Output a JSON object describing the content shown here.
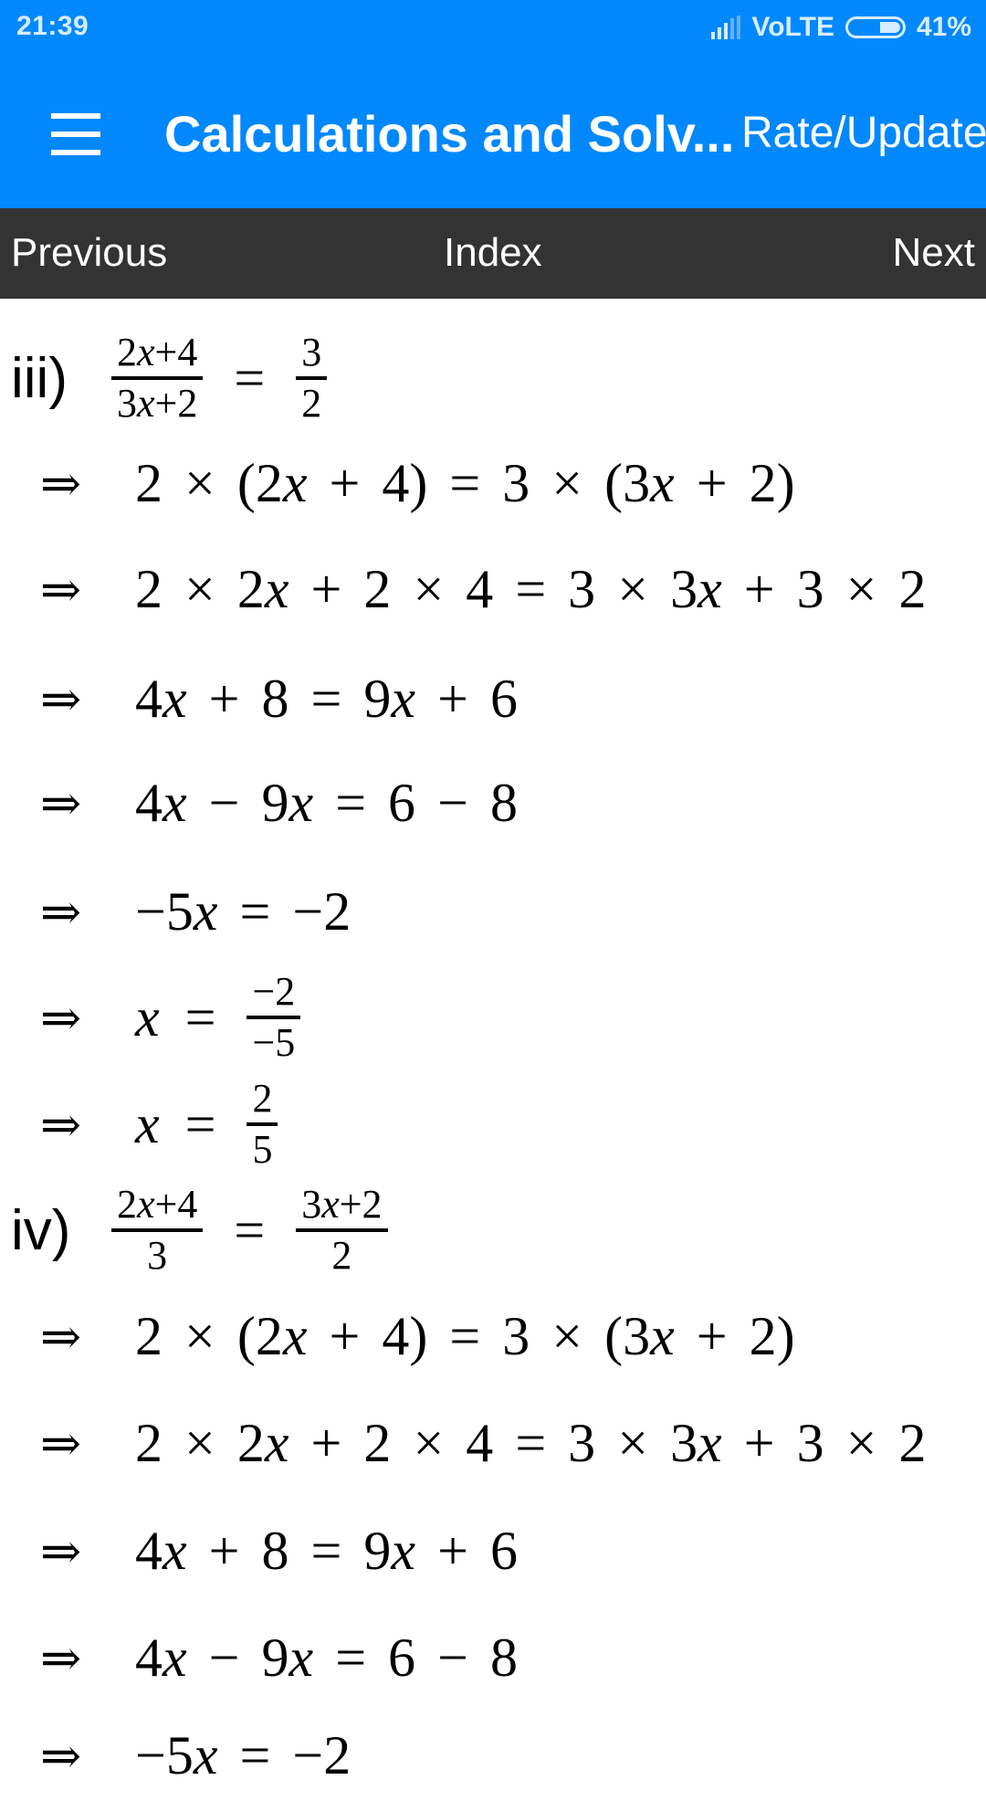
{
  "status_bar": {
    "time": "21:39",
    "network": "VoLTE",
    "battery_percent": "41%",
    "battery_level": 0.41,
    "signal_icon": "cell-signal-icon",
    "battery_icon": "battery-icon"
  },
  "app_bar": {
    "menu_icon": "hamburger-menu-icon",
    "title": "Calculations and Solv...",
    "rate_update_label": "Rate/Update"
  },
  "nav_bar": {
    "previous_label": "Previous",
    "index_label": "Index",
    "next_label": "Next"
  },
  "colors": {
    "primary": "#0288fd",
    "nav_background": "#333333",
    "text": "#000000"
  },
  "problems": [
    {
      "label": "iii)",
      "equation": {
        "lhs_num": "2x+4",
        "lhs_den": "3x+2",
        "eq": "=",
        "rhs_num": "3",
        "rhs_den": "2"
      },
      "arrow": "⇒",
      "steps": [
        "2 × (2x + 4) = 3 × (3x + 2)",
        "2 × 2x + 2 × 4 = 3 × 3x + 3 × 2",
        "4x + 8 = 9x + 6",
        "4x − 9x = 6 − 8",
        "−5x = −2"
      ],
      "frac_steps": [
        {
          "lhs": "x",
          "eq": "=",
          "num": "−2",
          "den": "−5"
        },
        {
          "lhs": "x",
          "eq": "=",
          "num": "2",
          "den": "5"
        }
      ]
    },
    {
      "label": "iv)",
      "equation": {
        "lhs_num": "2x+4",
        "lhs_den": "3",
        "eq": "=",
        "rhs_num": "3x+2",
        "rhs_den": "2"
      },
      "arrow": "⇒",
      "steps": [
        "2 × (2x + 4) = 3 × (3x + 2)",
        "2 × 2x + 2 × 4 = 3 × 3x + 3 × 2",
        "4x + 8 = 9x + 6",
        "4x − 9x = 6 − 8",
        "−5x = −2"
      ]
    }
  ]
}
